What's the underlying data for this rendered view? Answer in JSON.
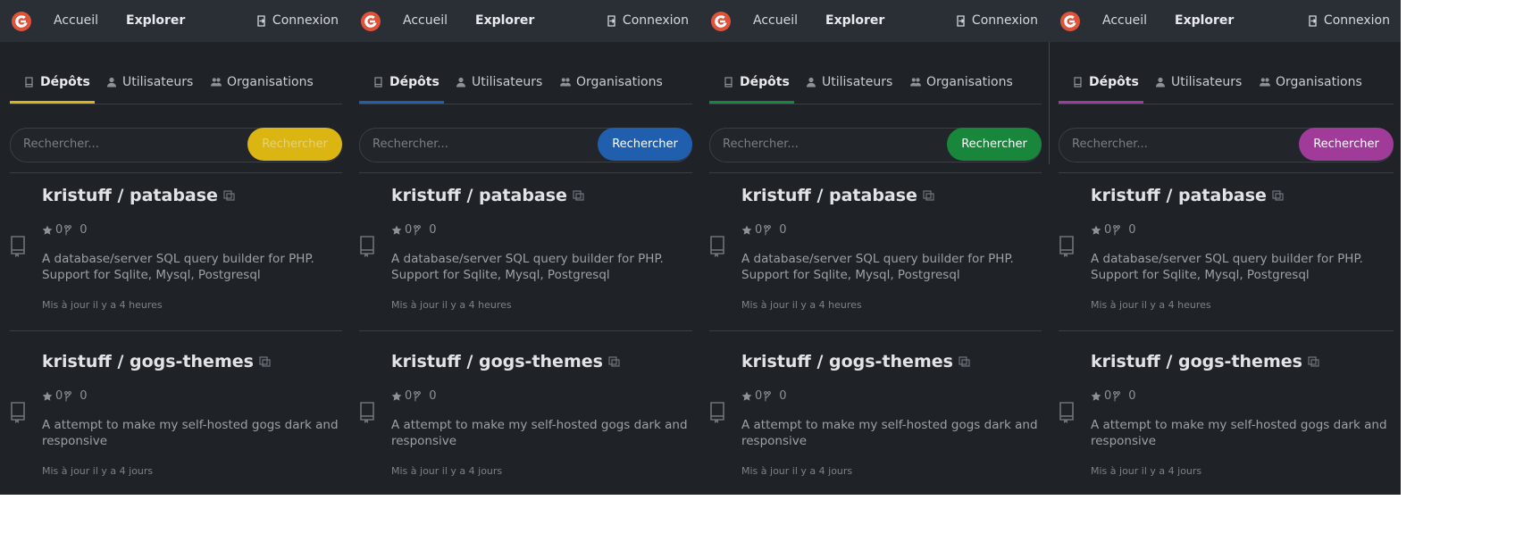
{
  "nav": {
    "home": "Accueil",
    "explore": "Explorer",
    "login": "Connexion"
  },
  "tabs": {
    "repos": "Dépôts",
    "users": "Utilisateurs",
    "orgs": "Organisations"
  },
  "search": {
    "placeholder": "Rechercher...",
    "button": "Rechercher"
  },
  "repos": [
    {
      "title": "kristuff / patabase",
      "stars": "0",
      "forks": "0",
      "description": "A database/server SQL query builder for PHP. Support for Sqlite, Mysql, Postgresql",
      "updated": "Mis à jour il y a 4 heures"
    },
    {
      "title": "kristuff / gogs-themes",
      "stars": "0",
      "forks": "0",
      "description": "A attempt to make my self-hosted gogs dark and responsive",
      "updated": "Mis à jour il y a 4 jours"
    }
  ],
  "themes": [
    {
      "accent": "#dbb512",
      "button_text": "#e6d27a"
    },
    {
      "accent": "#1f5fad",
      "button_text": "#ffffff"
    },
    {
      "accent": "#18873b",
      "button_text": "#ffffff"
    },
    {
      "accent": "#a03b9a",
      "button_text": "#ffffff"
    }
  ],
  "icons": {
    "logo": "gogs-logo-icon",
    "login": "sign-in-icon",
    "repo_tab": "repo-icon",
    "user_tab": "user-icon",
    "org_tab": "organization-icon",
    "repo_item": "repo-book-icon",
    "mirror": "mirror-icon",
    "star": "star-icon",
    "fork": "fork-icon"
  }
}
